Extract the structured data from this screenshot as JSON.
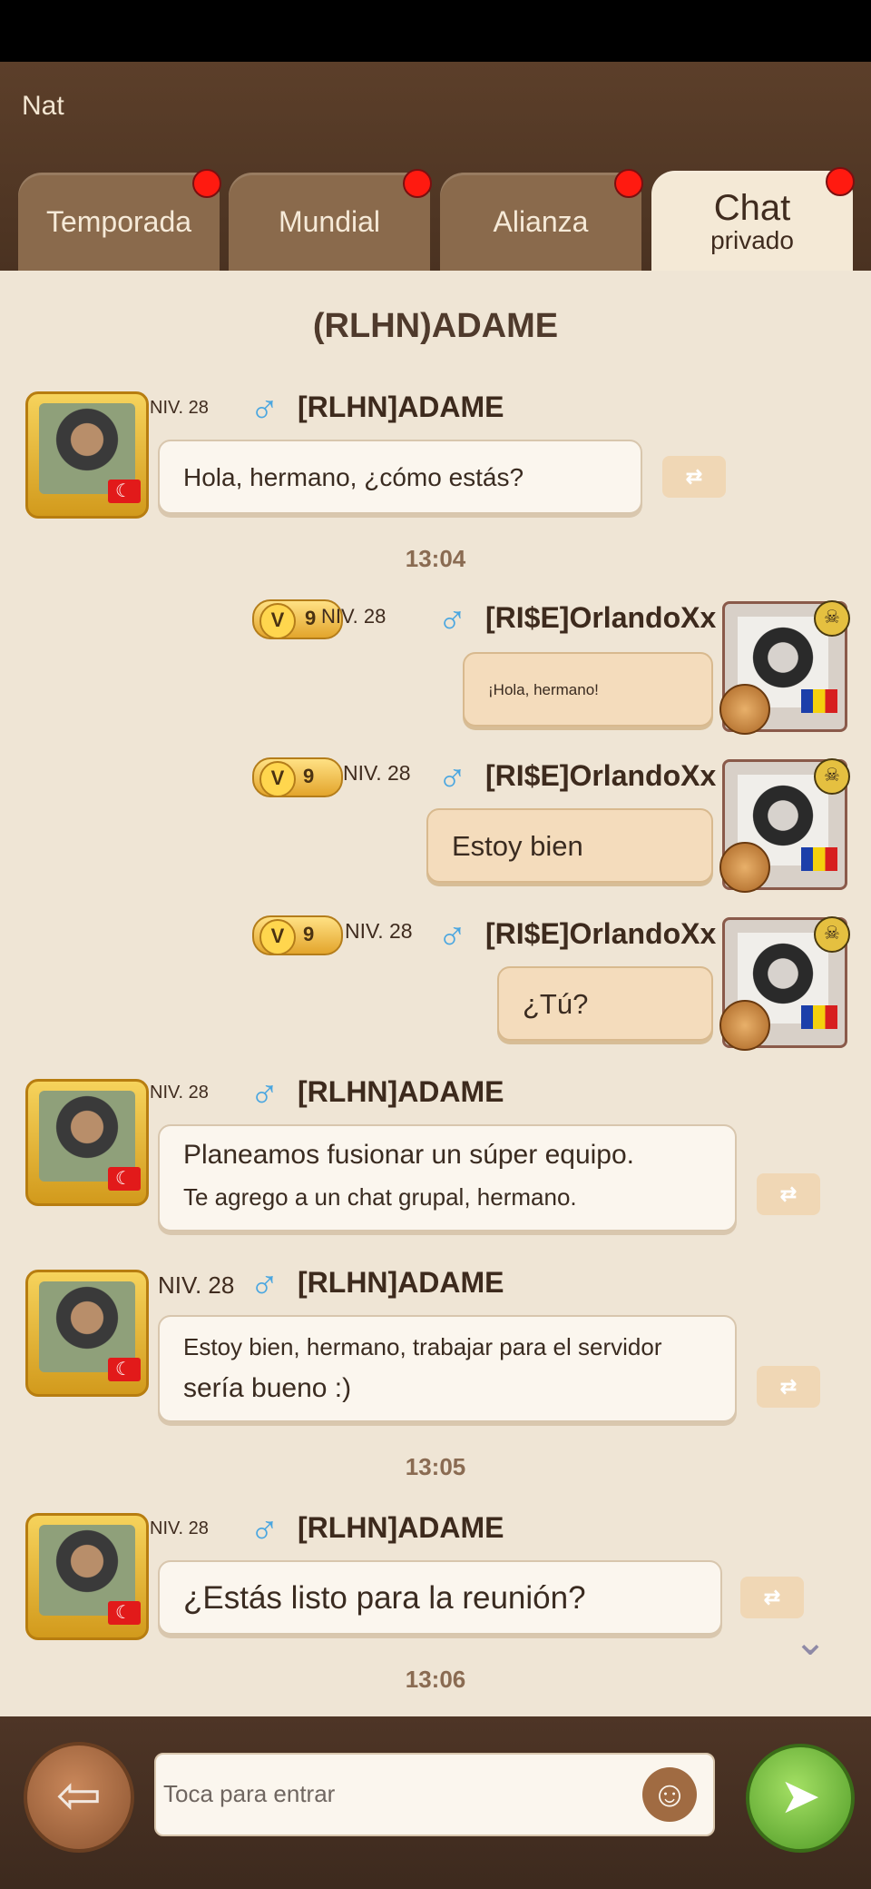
{
  "header": {
    "user_name": "Nat"
  },
  "tabs": [
    {
      "label": "Temporada"
    },
    {
      "label": "Mundial"
    },
    {
      "label": "Alianza"
    },
    {
      "label_line1": "Chat",
      "label_line2": "privado"
    }
  ],
  "chat": {
    "title": "(RLHN)ADAME",
    "messages": [
      {
        "level": "NIV. 28",
        "sender": "[RLHN]ADAME",
        "text": "Hola, hermano, ¿cómo estás?"
      },
      {
        "time": "13:04"
      },
      {
        "vip": "9",
        "level": "NIV. 28",
        "sender": "[RI$E]OrlandoXx",
        "text": "¡Hola, hermano!"
      },
      {
        "vip": "9",
        "level": "NIV. 28",
        "sender": "[RI$E]OrlandoXx",
        "text": "Estoy bien"
      },
      {
        "vip": "9",
        "level": "NIV. 28",
        "sender": "[RI$E]OrlandoXx",
        "text": "¿Tú?"
      },
      {
        "level": "NIV. 28",
        "sender": "[RLHN]ADAME",
        "text_line1": "Planeamos fusionar un súper equipo.",
        "text_line2": "Te agrego a un chat grupal, hermano."
      },
      {
        "level": "NIV. 28",
        "sender": "[RLHN]ADAME",
        "text_line1": "Estoy bien, hermano, trabajar para el servidor",
        "text_line2": "sería bueno :)"
      },
      {
        "time": "13:05"
      },
      {
        "level": "NIV. 28",
        "sender": "[RLHN]ADAME",
        "text": "¿Estás listo para la reunión?"
      },
      {
        "time": "13:06"
      }
    ]
  },
  "input": {
    "placeholder": "Toca para entrar"
  },
  "icons": {
    "gender": "male-icon",
    "translate": "translate-icon",
    "back": "back-arrow-icon",
    "emoji": "emoji-icon",
    "send": "send-icon",
    "scroll": "chevron-down-icon"
  },
  "colors": {
    "header_bg": "#4a3221",
    "chat_bg": "#efe5d5",
    "notification": "#ff1a10",
    "send_button": "#4f9a26"
  }
}
